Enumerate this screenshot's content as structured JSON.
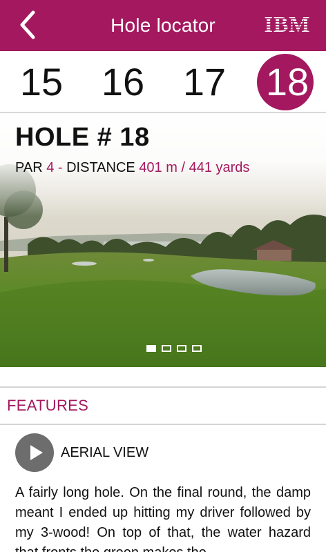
{
  "header": {
    "title": "Hole locator",
    "brand": "IBM",
    "brand_color": "#a3185e",
    "back_icon": "chevron-left-icon"
  },
  "holes": {
    "items": [
      {
        "label": "15"
      },
      {
        "label": "16"
      },
      {
        "label": "17"
      },
      {
        "label": "18"
      }
    ],
    "selected": "18"
  },
  "hole_info": {
    "title": "HOLE # 18",
    "par_label": "PAR",
    "par_value": "4 -",
    "distance_label": "DISTANCE",
    "distance_value": "401 m / 441 yards"
  },
  "gallery": {
    "page_count": 4,
    "current_page": 1
  },
  "features": {
    "label": "FEATURES",
    "aerial_view_label": "AERIAL VIEW",
    "play_icon": "play-icon",
    "description": "A fairly long hole. On the final round, the damp meant I ended up hitting my driver followed by my 3-wood! On top of that, the water hazard that fronts the green makes the"
  }
}
